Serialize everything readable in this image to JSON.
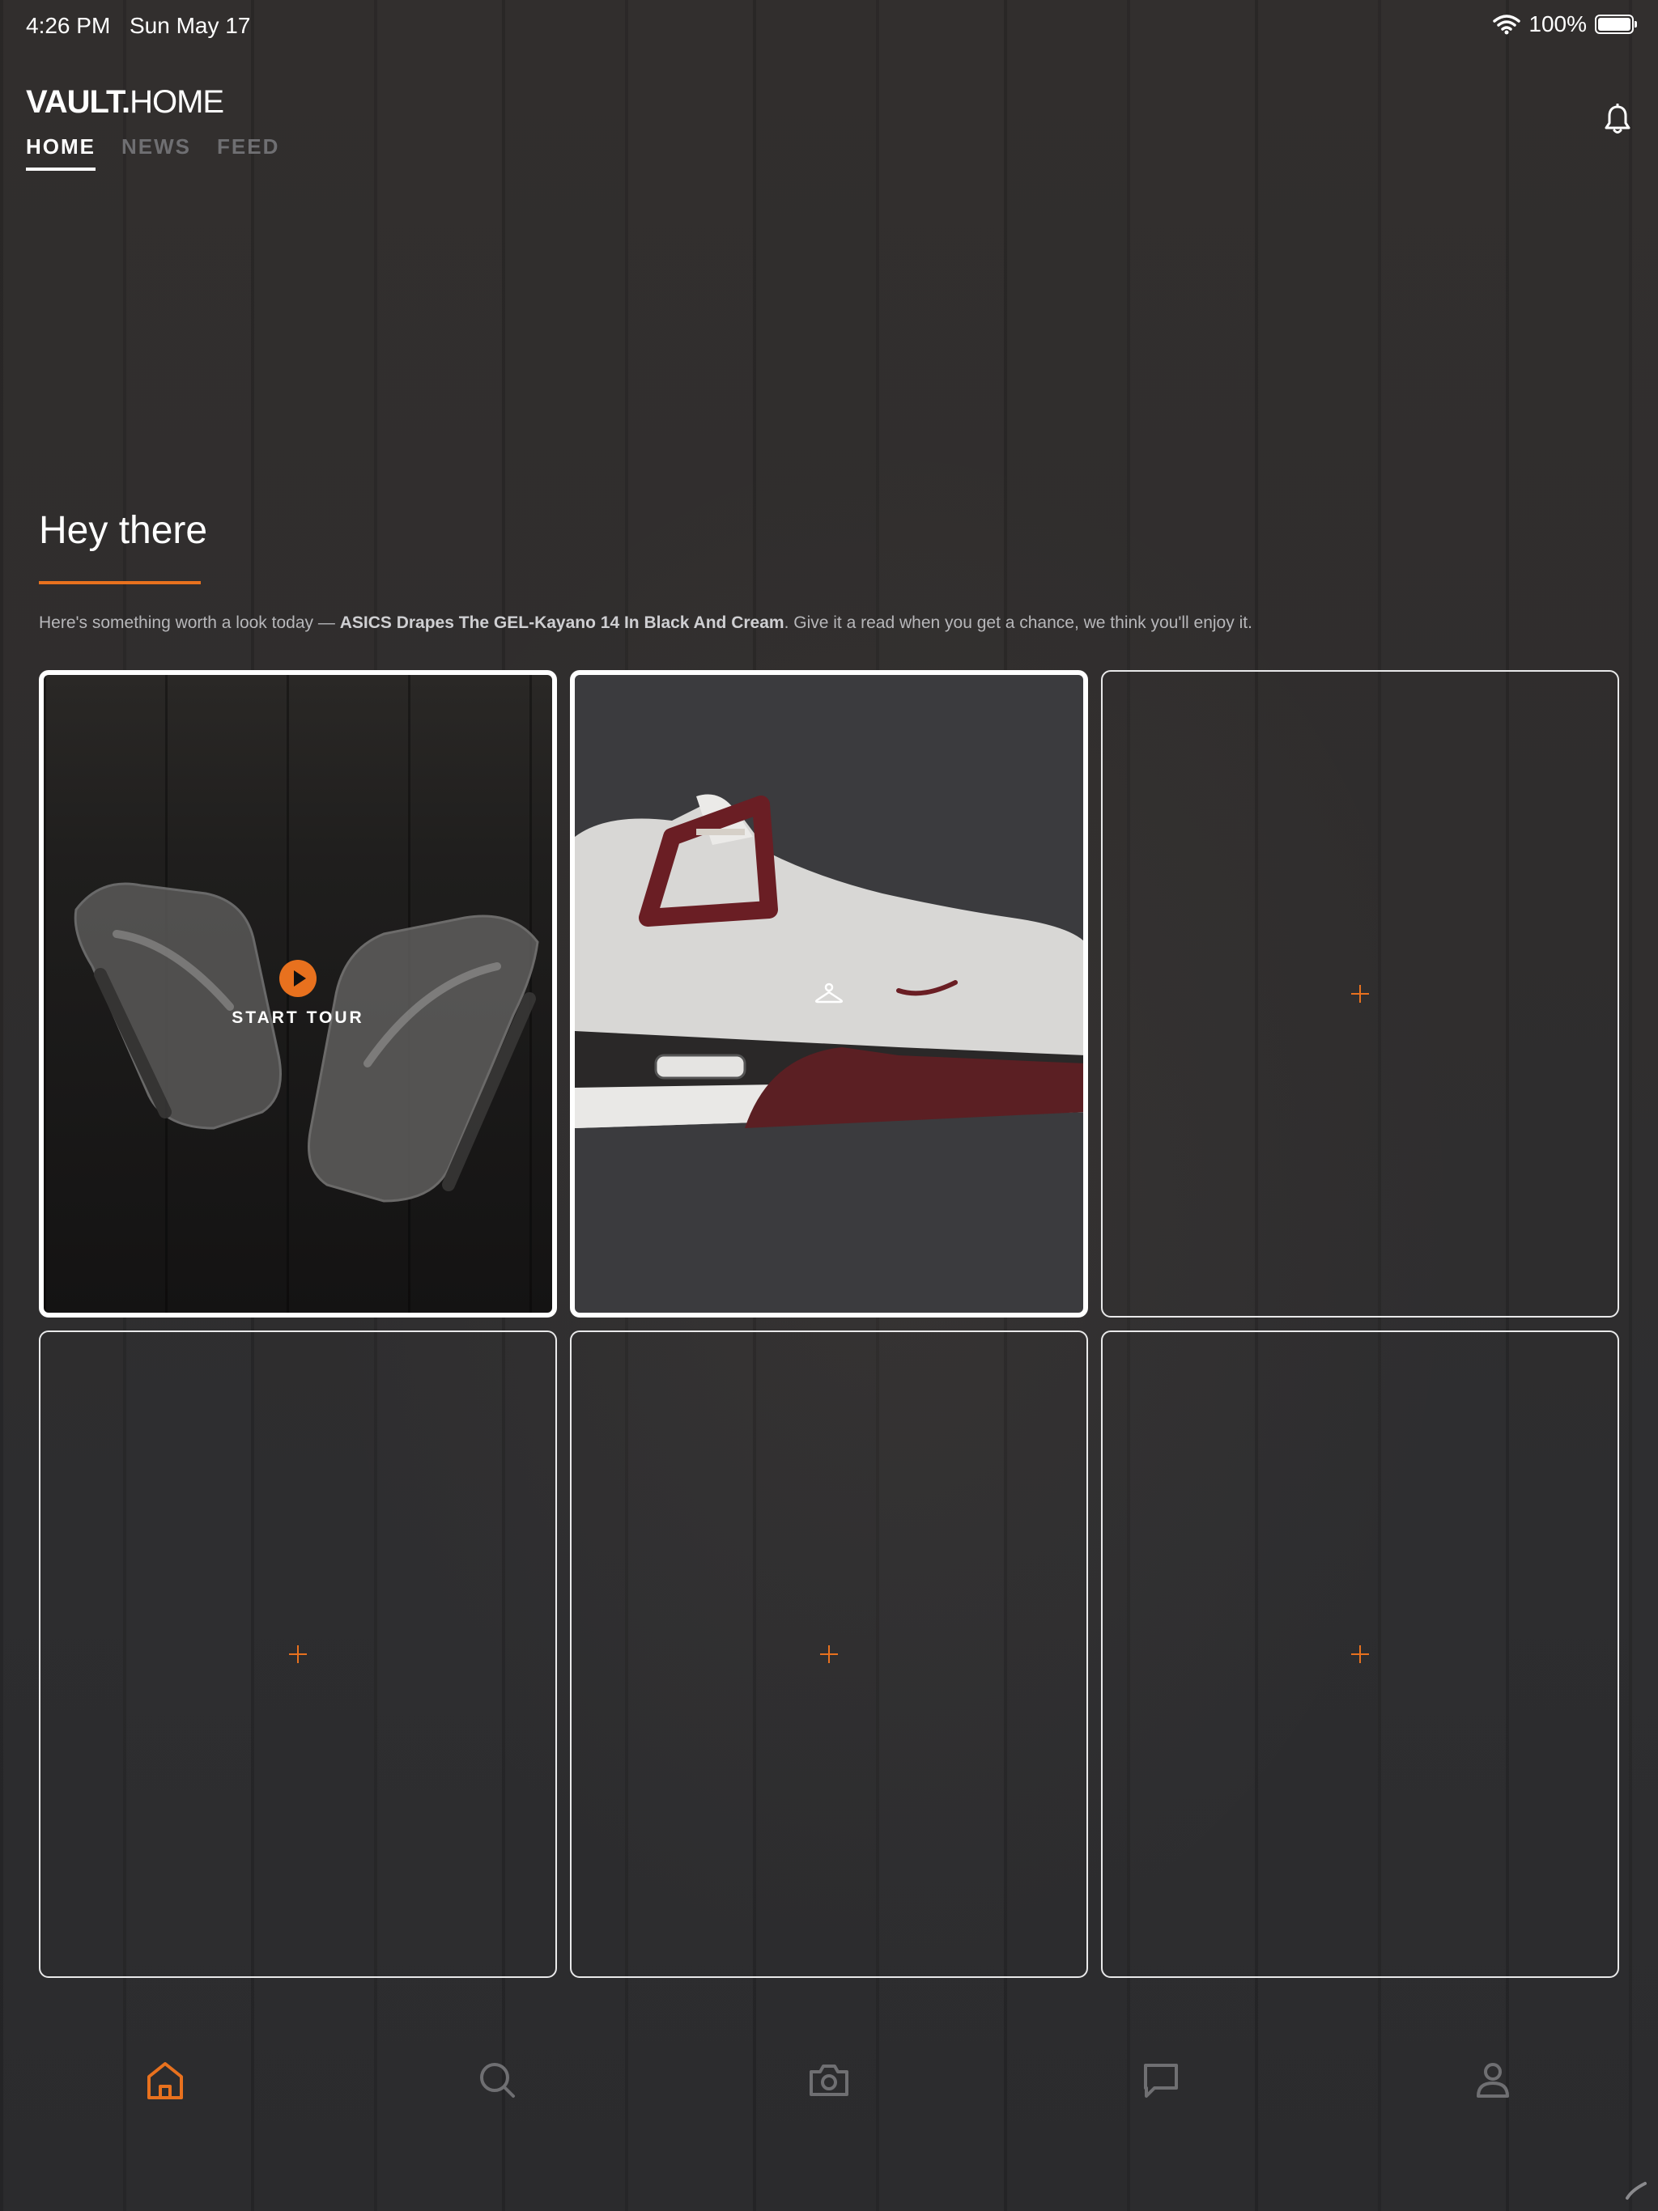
{
  "status_bar": {
    "time": "4:26 PM",
    "date": "Sun May 17",
    "battery": "100%"
  },
  "header": {
    "logo_bold": "VAULT.",
    "logo_light": "HOME",
    "tabs": [
      {
        "label": "HOME",
        "active": true
      },
      {
        "label": "NEWS",
        "active": false
      },
      {
        "label": "FEED",
        "active": false
      }
    ]
  },
  "greeting": {
    "title": "Hey there",
    "intro_prefix": "Here's something worth a look today — ",
    "intro_highlight": "ASICS Drapes The GEL-Kayano 14 In Black And Cream",
    "intro_suffix": ". Give it a read when you get a chance, we think you'll enjoy it."
  },
  "tiles": {
    "tour": {
      "label": "START TOUR"
    }
  },
  "bottom_tabs": [
    {
      "name": "home",
      "icon": "home-icon",
      "active": true
    },
    {
      "name": "search",
      "icon": "search-icon",
      "active": false
    },
    {
      "name": "camera",
      "icon": "camera-icon",
      "active": false
    },
    {
      "name": "messages",
      "icon": "chat-icon",
      "active": false
    },
    {
      "name": "profile",
      "icon": "person-icon",
      "active": false
    }
  ],
  "colors": {
    "accent": "#e8711e",
    "background": "#2b2b2d",
    "inactive": "#6f6f72"
  }
}
